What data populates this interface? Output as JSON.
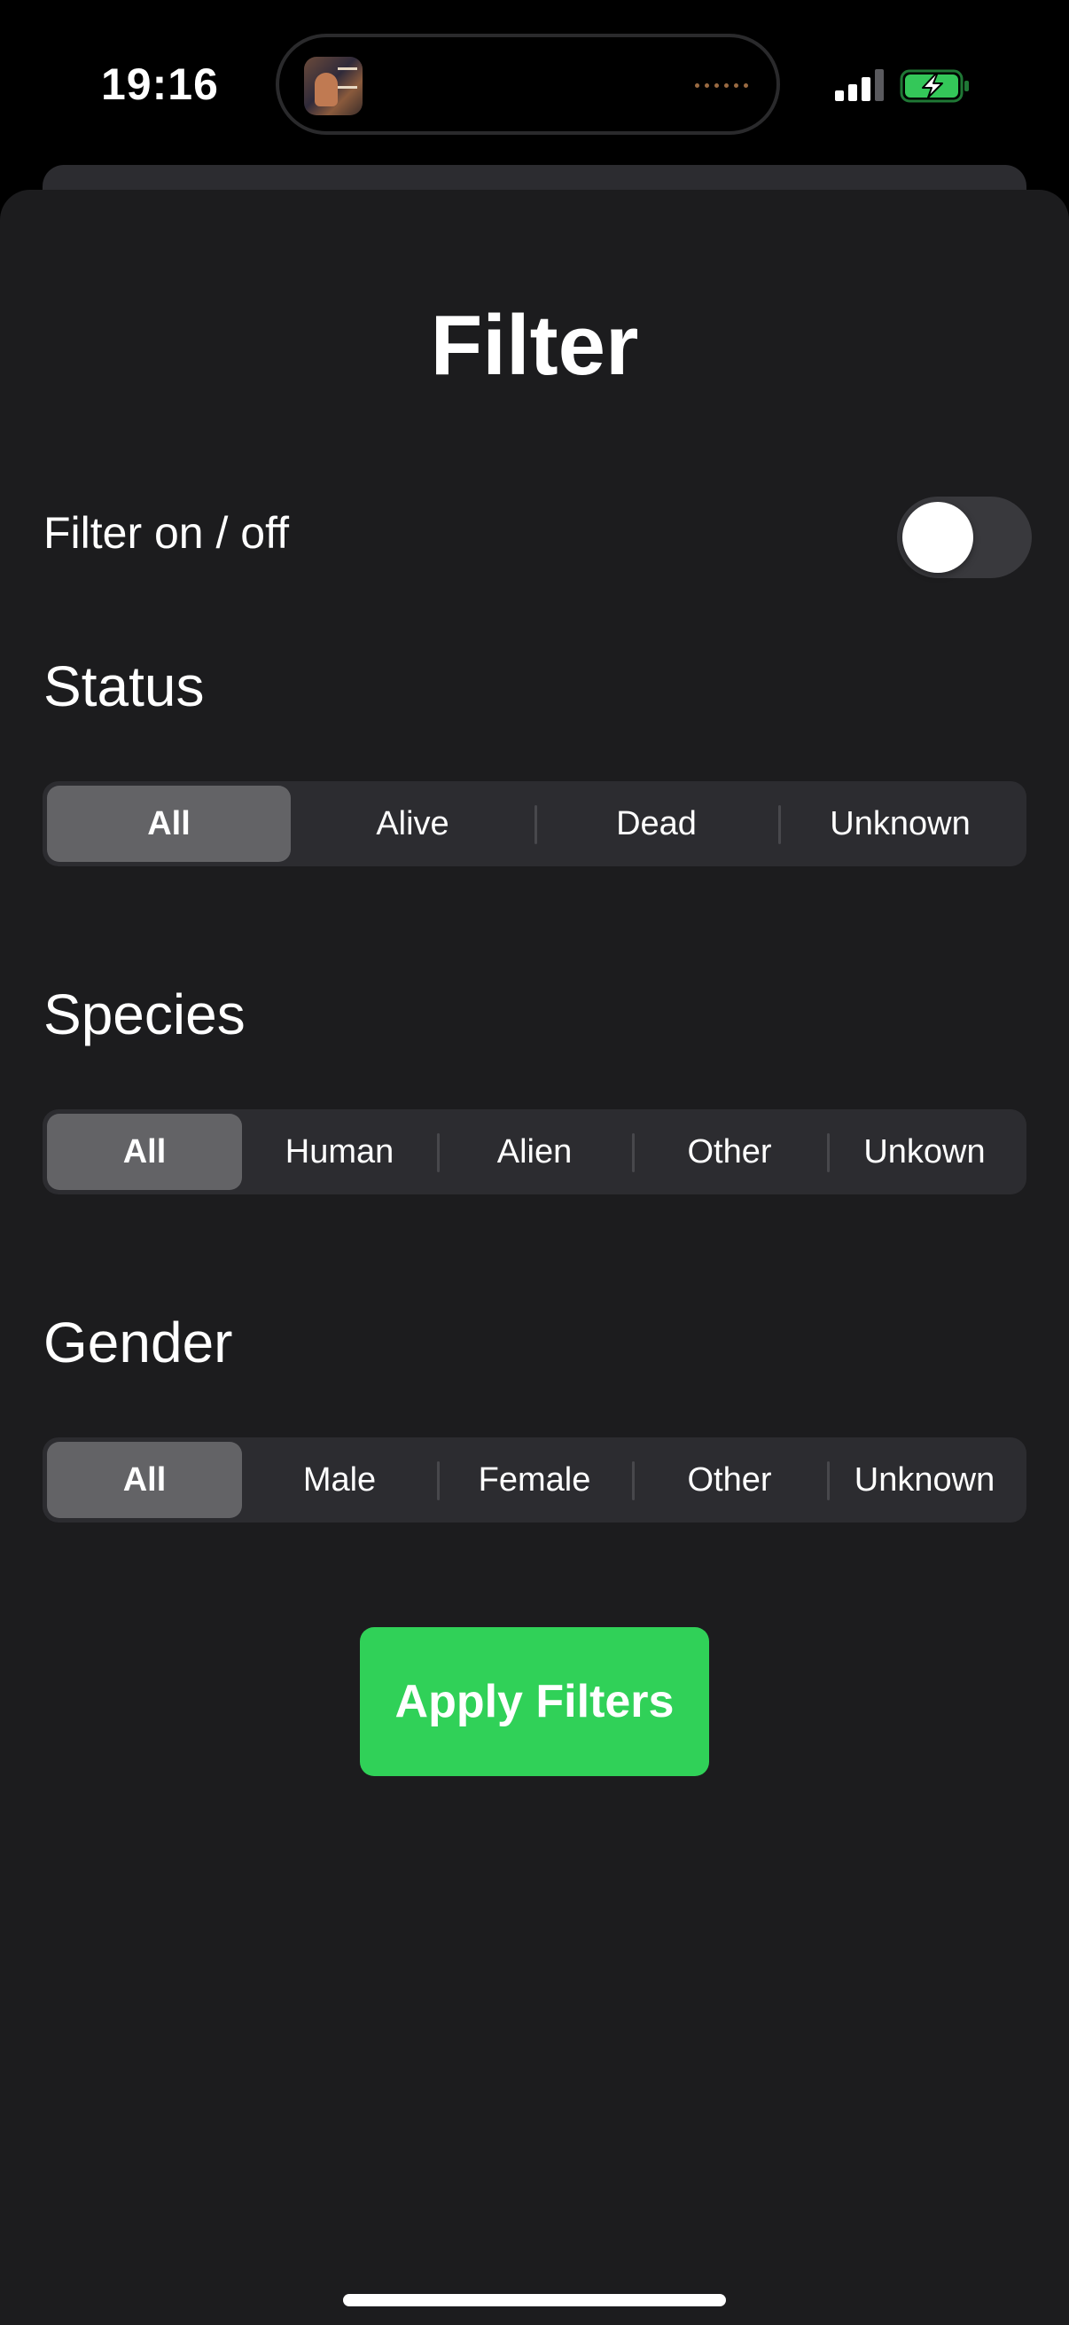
{
  "status_bar": {
    "time": "19:16",
    "icons": [
      "now-playing-artwork-icon",
      "audio-waveform-icon",
      "cellular-signal-icon",
      "battery-charging-icon"
    ],
    "battery_color": "#34c759"
  },
  "sheet": {
    "title": "Filter",
    "toggle": {
      "label": "Filter on / off",
      "state": "off"
    },
    "sections": [
      {
        "title": "Status",
        "options": [
          "All",
          "Alive",
          "Dead",
          "Unknown"
        ],
        "selected": "All"
      },
      {
        "title": "Species",
        "options": [
          "All",
          "Human",
          "Alien",
          "Other",
          "Unkown"
        ],
        "selected": "All"
      },
      {
        "title": "Gender",
        "options": [
          "All",
          "Male",
          "Female",
          "Other",
          "Unknown"
        ],
        "selected": "All"
      }
    ],
    "apply_button": "Apply Filters"
  },
  "colors": {
    "sheet_background": "#1c1c1e",
    "segment_track": "#2c2c30",
    "segment_selected": "#636366",
    "accent_green": "#30d158"
  }
}
